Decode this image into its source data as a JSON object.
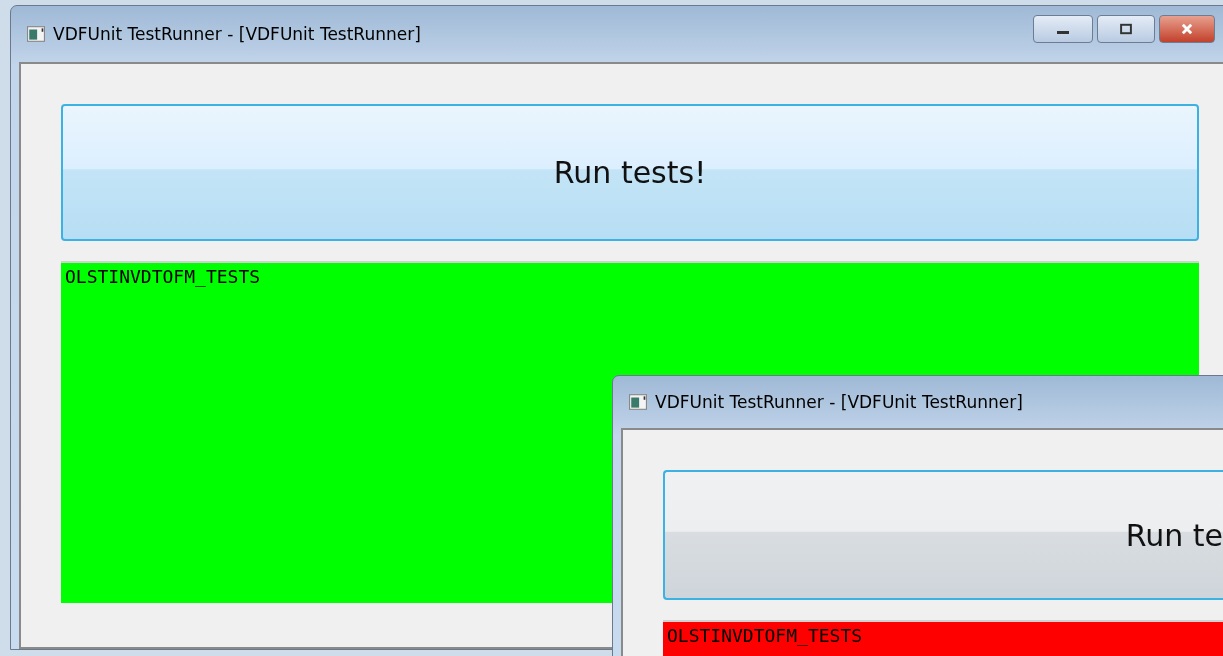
{
  "windows": [
    {
      "title": "VDFUnit TestRunner - [VDFUnit TestRunner]",
      "controls": true,
      "button": "Run tests!",
      "result": {
        "color": "#00ff00",
        "text": "OLSTINVDTOFM_TESTS"
      }
    },
    {
      "title": "VDFUnit TestRunner - [VDFUnit TestRunner]",
      "controls": false,
      "button": "Run te",
      "result": {
        "color": "#ff0000",
        "text": "OLSTINVDTOFM_TESTS"
      }
    }
  ]
}
